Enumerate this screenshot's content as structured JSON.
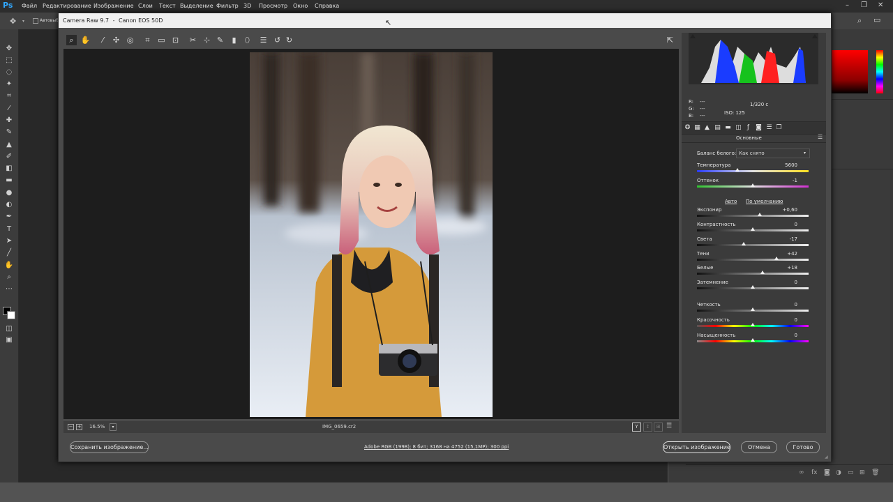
{
  "ps": {
    "logo": "Ps",
    "menu": [
      "Файл",
      "Редактирование",
      "Изображение",
      "Слои",
      "Текст",
      "Выделение",
      "Фильтр",
      "3D",
      "Просмотр",
      "Окно",
      "Справка"
    ],
    "options_prefix": "Автовыб"
  },
  "dialog": {
    "title_app": "Camera Raw 9.7",
    "title_sep": "-",
    "title_camera": "Canon EOS 50D",
    "zoom": "16.5%",
    "filename": "IMG_0659.cr2",
    "workflow_link": "Adobe RGB (1998); 8 бит; 3168 на 4752 (15,1МР); 300 ppi",
    "buttons": {
      "save": "Сохранить изображение...",
      "open": "Открыть изображение",
      "cancel": "Отмена",
      "done": "Готово"
    }
  },
  "info": {
    "r_label": "R:",
    "r_value": "---",
    "g_label": "G:",
    "g_value": "---",
    "b_label": "B:",
    "b_value": "---",
    "shutter": "1/320 с",
    "iso": "ISO: 125"
  },
  "basic": {
    "section_title": "Основные",
    "wb_label": "Баланс белого:",
    "wb_value": "Как снято",
    "auto_link": "Авто",
    "default_link": "По умолчанию",
    "sliders": [
      {
        "label": "Температура",
        "value": "5600",
        "level": 0.36
      },
      {
        "label": "Оттенок",
        "value": "-1",
        "level": 0.5
      },
      {
        "label": "Экспонир",
        "value": "+0,60",
        "level": 0.56
      },
      {
        "label": "Контрастность",
        "value": "0",
        "level": 0.5
      },
      {
        "label": "Света",
        "value": "-17",
        "level": 0.42
      },
      {
        "label": "Тени",
        "value": "+42",
        "level": 0.71
      },
      {
        "label": "Белые",
        "value": "+18",
        "level": 0.59
      },
      {
        "label": "Затемнение",
        "value": "0",
        "level": 0.5
      },
      {
        "label": "Четкость",
        "value": "0",
        "level": 0.5
      },
      {
        "label": "Красочность",
        "value": "0",
        "level": 0.5
      },
      {
        "label": "Насыщенность",
        "value": "0",
        "level": 0.5
      }
    ]
  },
  "colors": {
    "accent": "#31a8ff",
    "swatch_red": "#ff0000"
  }
}
